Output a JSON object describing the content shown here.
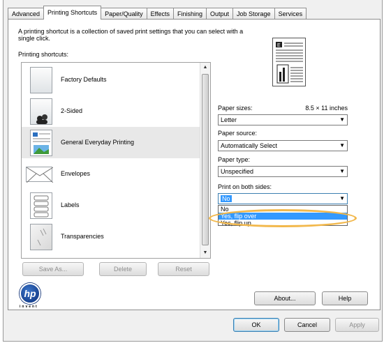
{
  "tabs": [
    "Advanced",
    "Printing Shortcuts",
    "Paper/Quality",
    "Effects",
    "Finishing",
    "Output",
    "Job Storage",
    "Services"
  ],
  "active_tab": "Printing Shortcuts",
  "description": "A printing shortcut is a collection of saved print settings that you can select with a single click.",
  "shortcuts_label": "Printing shortcuts:",
  "shortcuts": [
    {
      "label": "Factory Defaults",
      "icon": "blank-page-icon"
    },
    {
      "label": "2-Sided",
      "icon": "two-sided-pages-icon"
    },
    {
      "label": "General Everyday Printing",
      "icon": "document-image-icon",
      "selected": true
    },
    {
      "label": "Envelopes",
      "icon": "envelope-icon"
    },
    {
      "label": "Labels",
      "icon": "labels-sheet-icon"
    },
    {
      "label": "Transparencies",
      "icon": "transparency-icon"
    }
  ],
  "list_buttons": {
    "save_as": "Save As...",
    "delete": "Delete",
    "reset": "Reset"
  },
  "paper_sizes": {
    "label": "Paper sizes:",
    "dimension": "8.5 × 11 inches",
    "value": "Letter"
  },
  "paper_source": {
    "label": "Paper source:",
    "value": "Automatically Select"
  },
  "paper_type": {
    "label": "Paper type:",
    "value": "Unspecified"
  },
  "print_both_sides": {
    "label": "Print on both sides:",
    "value": "No",
    "options": [
      "No",
      "Yes, flip over",
      "Yes, flip up"
    ],
    "highlighted": "Yes, flip over"
  },
  "brand": {
    "logo_text": "hp",
    "tagline": "invent"
  },
  "bottom_buttons": {
    "about": "About...",
    "help": "Help",
    "ok": "OK",
    "cancel": "Cancel",
    "apply": "Apply"
  },
  "colors": {
    "highlight": "#3399ff",
    "callout_ring": "#f2b84c",
    "selected_row": "#e8e8e8"
  }
}
